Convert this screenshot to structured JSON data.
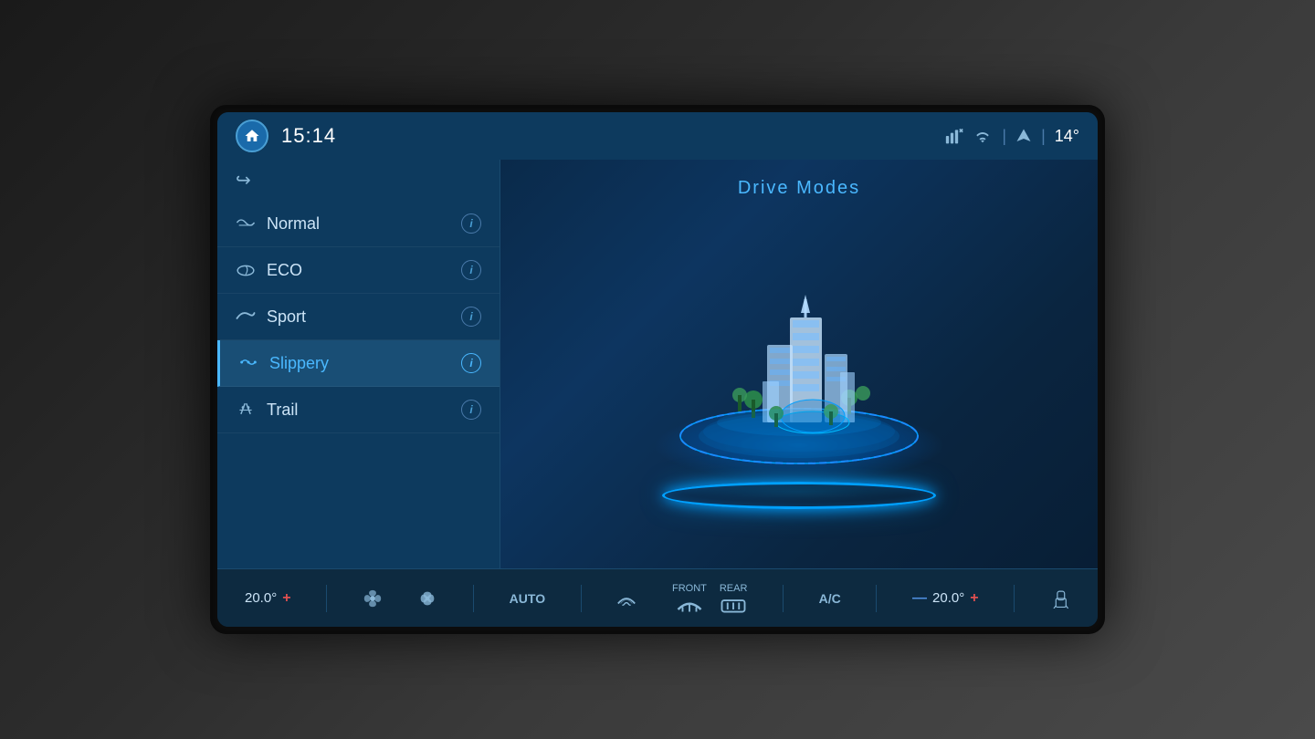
{
  "screen": {
    "time": "15:14",
    "temperature": "14°",
    "title": "Drive Modes"
  },
  "drive_modes": {
    "items": [
      {
        "id": "normal",
        "label": "Normal",
        "icon": "road",
        "active": false
      },
      {
        "id": "eco",
        "label": "ECO",
        "icon": "eco",
        "active": false
      },
      {
        "id": "sport",
        "label": "Sport",
        "icon": "sport",
        "active": false
      },
      {
        "id": "slippery",
        "label": "Slippery",
        "icon": "snowflake",
        "active": true
      },
      {
        "id": "trail",
        "label": "Trail",
        "icon": "trail",
        "active": false
      }
    ]
  },
  "climate": {
    "left_temp": "20.0°",
    "right_temp": "20.0°",
    "mode": "AUTO",
    "front_label": "FRONT",
    "rear_label": "REAR",
    "ac_label": "A/C"
  },
  "icons": {
    "home": "⌂",
    "back": "↩",
    "info": "i",
    "plus": "+",
    "minus": "—",
    "seat": "🪑",
    "nav": "▲"
  }
}
